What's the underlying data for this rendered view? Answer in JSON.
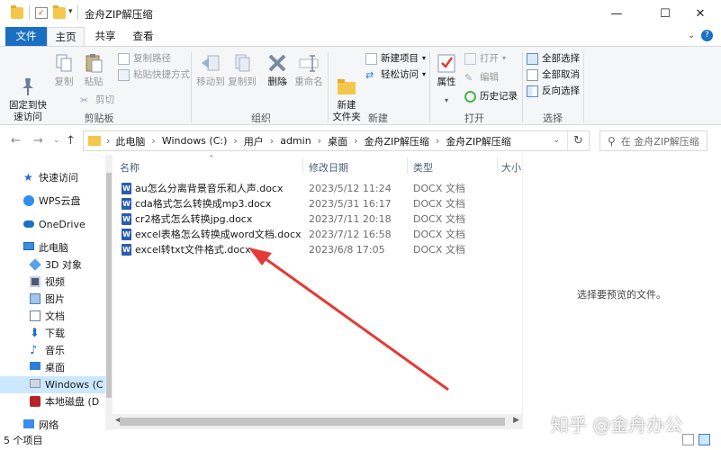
{
  "window": {
    "title": "金舟ZIP解压缩",
    "minimize": "—",
    "maximize": "☐",
    "close": "✕"
  },
  "tabs": [
    {
      "label": "文件"
    },
    {
      "label": "主页"
    },
    {
      "label": "共享"
    },
    {
      "label": "查看"
    }
  ],
  "ribbon": {
    "clipboard": {
      "pin": "固定到快\n速访问",
      "copy": "复制",
      "paste": "粘贴",
      "copy_path": "复制路径",
      "paste_shortcut": "粘贴快捷方式",
      "cut": "剪切",
      "label": "剪贴板"
    },
    "organize": {
      "move_to": "移动到",
      "copy_to": "复制到",
      "delete": "删除",
      "rename": "重命名",
      "label": "组织"
    },
    "new": {
      "new_folder": "新建\n文件夹",
      "new_item": "新建项目",
      "easy_access": "轻松访问",
      "label": "新建"
    },
    "open": {
      "properties": "属性",
      "open": "打开",
      "edit": "编辑",
      "history": "历史记录",
      "label": "打开"
    },
    "select": {
      "select_all": "全部选择",
      "select_none": "全部取消",
      "invert": "反向选择",
      "label": "选择"
    }
  },
  "address": {
    "crumbs": [
      "此电脑",
      "Windows (C:)",
      "用户",
      "admin",
      "桌面",
      "金舟ZIP解压缩",
      "金舟ZIP解压缩"
    ],
    "search_placeholder": "在 金舟ZIP解压缩"
  },
  "nav": [
    {
      "label": "快速访问"
    },
    {
      "label": "WPS云盘"
    },
    {
      "label": "OneDrive"
    },
    {
      "label": "此电脑"
    },
    {
      "label": "3D 对象"
    },
    {
      "label": "视频"
    },
    {
      "label": "图片"
    },
    {
      "label": "文档"
    },
    {
      "label": "下载"
    },
    {
      "label": "音乐"
    },
    {
      "label": "桌面"
    },
    {
      "label": "Windows (C"
    },
    {
      "label": "本地磁盘 (D"
    },
    {
      "label": "网络"
    }
  ],
  "columns": {
    "name": "名称",
    "date": "修改日期",
    "type": "类型",
    "size": "大小"
  },
  "files": [
    {
      "name": "au怎么分离背景音乐和人声.docx",
      "date": "2023/5/12 11:24",
      "type": "DOCX 文档"
    },
    {
      "name": "cda格式怎么转换成mp3.docx",
      "date": "2023/5/31 16:17",
      "type": "DOCX 文档"
    },
    {
      "name": "cr2格式怎么转换jpg.docx",
      "date": "2023/7/11 20:18",
      "type": "DOCX 文档"
    },
    {
      "name": "excel表格怎么转换成word文档.docx",
      "date": "2023/7/12 16:58",
      "type": "DOCX 文档"
    },
    {
      "name": "excel转txt文件格式.docx",
      "date": "2023/6/8 17:05",
      "type": "DOCX 文档"
    }
  ],
  "preview": {
    "text": "选择要预览的文件。"
  },
  "status": {
    "count": "5 个项目"
  },
  "watermark": "知乎 @金舟办公",
  "colors": {
    "accent": "#1a6fc3",
    "arrow": "#e53935",
    "selected": "#cce8ff"
  }
}
